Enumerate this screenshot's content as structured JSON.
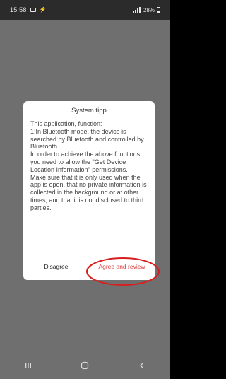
{
  "status_bar": {
    "time": "15:58",
    "battery": "28%"
  },
  "dialog": {
    "title": "System tipp",
    "lines": [
      "This application, function:",
      "1:In Bluetooth mode, the device is searched by Bluetooth and controlled by Bluetooth.",
      "In order to achieve the above functions, you need to allow the \"Get Device Location Information\" permissions.",
      "Make sure that it is only used when the app is open, that no private information is collected in the background or at other times, and that it is not disclosed to third parties."
    ],
    "disagree_label": "Disagree",
    "agree_label": "Agree and review"
  },
  "colors": {
    "accent_red": "#e03b3b",
    "overlay": "#6f6f6f",
    "annotation": "#d81f1f"
  },
  "icons": {
    "nav_recent": "recent-apps-icon",
    "nav_home": "home-icon",
    "nav_back": "back-icon"
  }
}
